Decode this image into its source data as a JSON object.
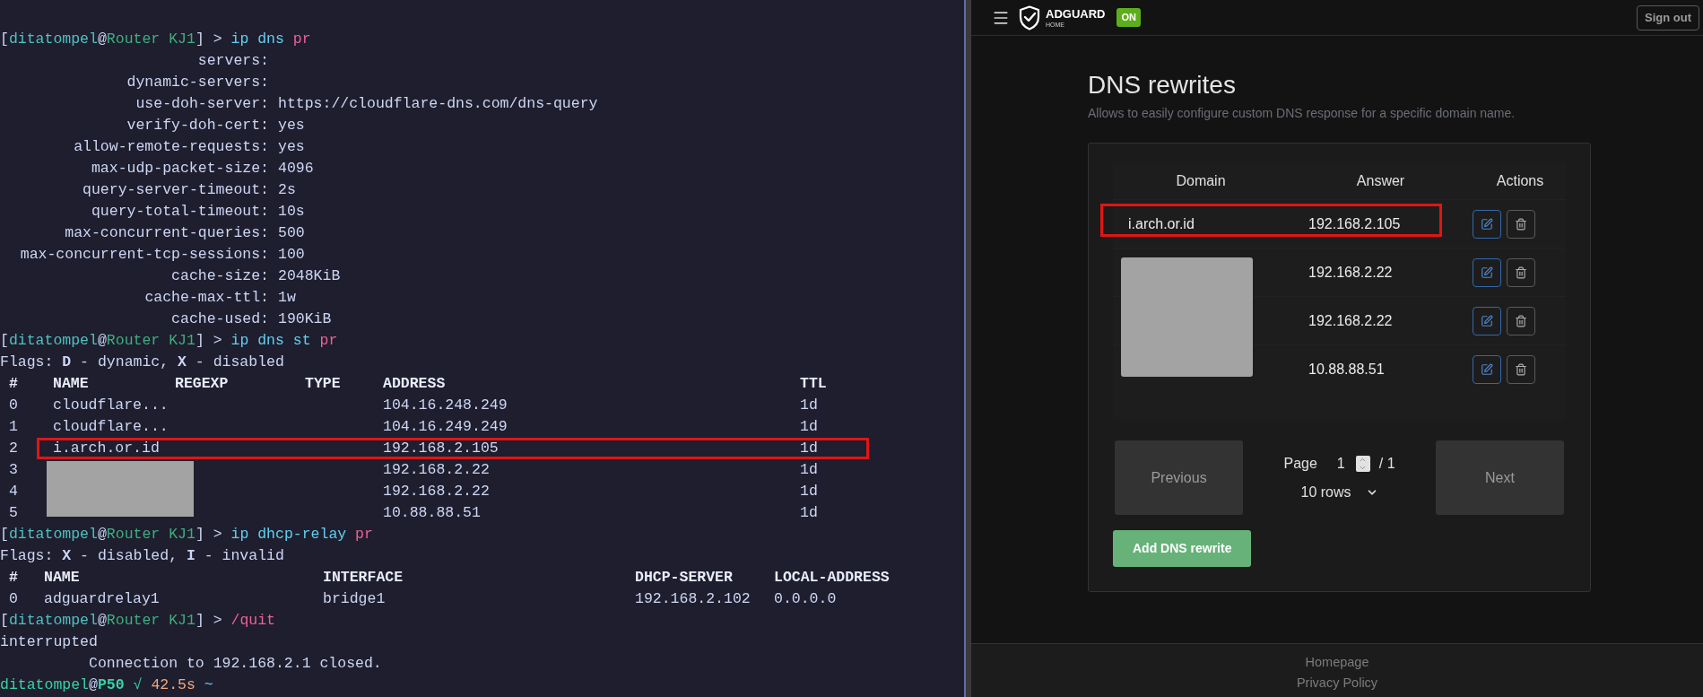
{
  "terminal": {
    "lines": [
      {
        "kind": "prompt",
        "parts": [
          {
            "text": "[",
            "kind": "plain"
          },
          {
            "text": "ditatompel",
            "kind": "user"
          },
          {
            "text": "@",
            "kind": "plain"
          },
          {
            "text": "Router KJ1",
            "kind": "host"
          },
          {
            "text": "] > ",
            "kind": "plain"
          },
          {
            "text": "ip dns ",
            "kind": "command"
          },
          {
            "text": "pr",
            "kind": "arg"
          }
        ]
      },
      {
        "kind": "kv",
        "key": "servers:"
      },
      {
        "kind": "kv",
        "key": "dynamic-servers:"
      },
      {
        "kind": "kv",
        "key": "use-doh-server:",
        "value": "https://cloudflare-dns.com/dns-query"
      },
      {
        "kind": "kv",
        "key": "verify-doh-cert:",
        "value": "yes"
      },
      {
        "kind": "kv",
        "key": "allow-remote-requests:",
        "value": "yes"
      },
      {
        "kind": "kv",
        "key": "max-udp-packet-size:",
        "value": "4096"
      },
      {
        "kind": "kv",
        "key": "query-server-timeout:",
        "value": "2s"
      },
      {
        "kind": "kv",
        "key": "query-total-timeout:",
        "value": "10s"
      },
      {
        "kind": "kv",
        "key": "max-concurrent-queries:",
        "value": "500"
      },
      {
        "kind": "kv",
        "key": "max-concurrent-tcp-sessions:",
        "value": "100"
      },
      {
        "kind": "kv",
        "key": "cache-size:",
        "value": "2048KiB"
      },
      {
        "kind": "kv",
        "key": "cache-max-ttl:",
        "value": "1w"
      },
      {
        "kind": "kv",
        "key": "cache-used:",
        "value": "190KiB"
      },
      {
        "kind": "prompt",
        "parts": [
          {
            "text": "[",
            "kind": "plain"
          },
          {
            "text": "ditatompel",
            "kind": "user"
          },
          {
            "text": "@",
            "kind": "plain"
          },
          {
            "text": "Router KJ1",
            "kind": "host"
          },
          {
            "text": "] > ",
            "kind": "plain"
          },
          {
            "text": "ip dns st ",
            "kind": "command"
          },
          {
            "text": "pr",
            "kind": "arg"
          }
        ]
      },
      {
        "kind": "text",
        "text": "Flags: **D** - dynamic, **X** - disabled"
      },
      {
        "kind": "table",
        "columns": [
          "#",
          "NAME",
          "REGEXP",
          "TYPE",
          "ADDRESS",
          "TTL"
        ],
        "rows": [
          {
            "num": "0",
            "name": "cloudflare...",
            "address": "104.16.248.249",
            "ttl": "1d",
            "highlighted": false,
            "redacted": false
          },
          {
            "num": "1",
            "name": "cloudflare...",
            "address": "104.16.249.249",
            "ttl": "1d",
            "highlighted": false,
            "redacted": false
          },
          {
            "num": "2",
            "name": "i.arch.or.id",
            "address": "192.168.2.105",
            "ttl": "1d",
            "highlighted": true,
            "redacted": false
          },
          {
            "num": "3",
            "address": "192.168.2.22",
            "ttl": "1d",
            "highlighted": false,
            "redacted": true
          },
          {
            "num": "4",
            "address": "192.168.2.22",
            "ttl": "1d",
            "highlighted": false,
            "redacted": true
          },
          {
            "num": "5",
            "address": "10.88.88.51",
            "ttl": "1d",
            "highlighted": false,
            "redacted": true
          }
        ]
      },
      {
        "kind": "prompt",
        "parts": [
          {
            "text": "[",
            "kind": "plain"
          },
          {
            "text": "ditatompel",
            "kind": "user"
          },
          {
            "text": "@",
            "kind": "plain"
          },
          {
            "text": "Router KJ1",
            "kind": "host"
          },
          {
            "text": "] > ",
            "kind": "plain"
          },
          {
            "text": "ip dhcp-relay ",
            "kind": "command"
          },
          {
            "text": "pr",
            "kind": "arg"
          }
        ]
      },
      {
        "kind": "text",
        "text": "Flags: **X** - disabled, **I** - invalid"
      },
      {
        "kind": "table",
        "columns": [
          "#",
          "NAME",
          "INTERFACE",
          "DHCP-SERVER",
          "LOCAL-ADDRESS"
        ],
        "rows": [
          {
            "num": "0",
            "name": "adguardrelay1",
            "interface": "bridge1",
            "server": "192.168.2.102",
            "local": "0.0.0.0"
          }
        ]
      },
      {
        "kind": "prompt",
        "parts": [
          {
            "text": "[",
            "kind": "plain"
          },
          {
            "text": "ditatompel",
            "kind": "user"
          },
          {
            "text": "@",
            "kind": "plain"
          },
          {
            "text": "Router KJ1",
            "kind": "host"
          },
          {
            "text": "] > ",
            "kind": "plain"
          },
          {
            "text": "/quit",
            "kind": "arg"
          }
        ]
      },
      {
        "kind": "text",
        "text": "interrupted"
      },
      {
        "kind": "text",
        "text": "          Connection to 192.168.2.1 closed."
      },
      {
        "kind": "prompt",
        "parts": [
          {
            "text": "ditatompel",
            "kind": "ok"
          },
          {
            "text": "@",
            "kind": "plain"
          },
          {
            "text": "P50",
            "kind": "okbold"
          },
          {
            "text": " √ ",
            "kind": "ok"
          },
          {
            "text": "42.5s",
            "kind": "duration"
          },
          {
            "text": " ~",
            "kind": "command"
          }
        ]
      }
    ]
  },
  "adguard": {
    "brand": "ADGUARD",
    "brand_sub": "HOME",
    "status": "ON",
    "sign_out": "Sign out",
    "title": "DNS rewrites",
    "subtitle": "Allows to easily configure custom DNS response for a specific domain name.",
    "columns": [
      "Domain",
      "Answer",
      "Actions"
    ],
    "rows": [
      {
        "domain": "i.arch.or.id",
        "answer": "192.168.2.105",
        "highlighted": true,
        "redacted": false
      },
      {
        "answer": "192.168.2.22",
        "highlighted": false,
        "redacted": true
      },
      {
        "answer": "192.168.2.22",
        "highlighted": false,
        "redacted": true
      },
      {
        "answer": "10.88.88.51",
        "highlighted": false,
        "redacted": true
      }
    ],
    "pagination": {
      "previous": "Previous",
      "next": "Next",
      "page_label": "Page",
      "page": "1",
      "total": "/ 1",
      "rows_per_page": "10 rows"
    },
    "add_button": "Add DNS rewrite",
    "footer_links": [
      "Homepage",
      "Privacy Policy"
    ]
  }
}
